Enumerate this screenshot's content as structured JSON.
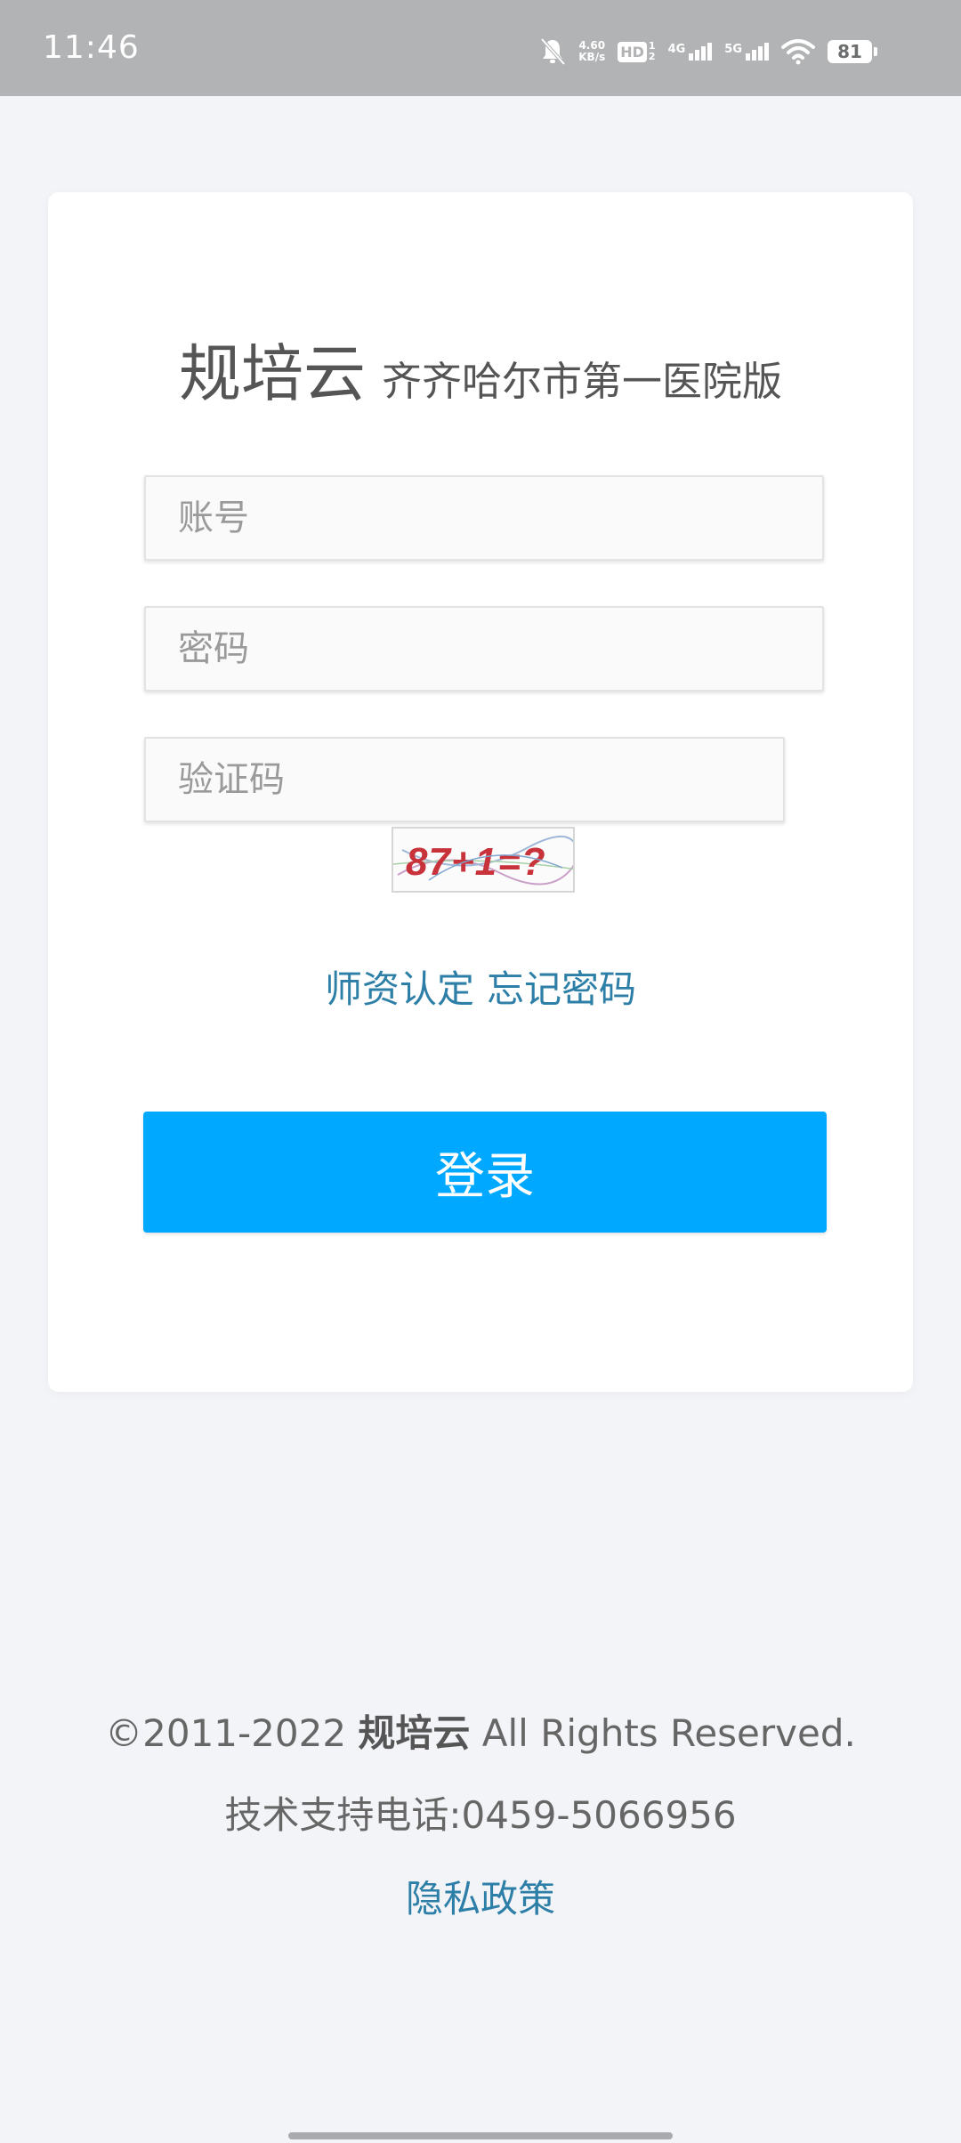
{
  "status_bar": {
    "time": "11:46",
    "net_speed_value": "4.60",
    "net_speed_unit": "KB/s",
    "hd_label": "HD",
    "hd_sub_top": "1",
    "hd_sub_bottom": "2",
    "sim1_label": "4G",
    "sim2_label": "5G",
    "battery": "81"
  },
  "brand": {
    "name": "规培云",
    "subtitle": "齐齐哈尔市第一医院版"
  },
  "form": {
    "account_placeholder": "账号",
    "password_placeholder": "密码",
    "captcha_placeholder": "验证码",
    "captcha_text": "87+1=?"
  },
  "links": {
    "teacher_cert": "师资认定",
    "forgot_password": "忘记密码"
  },
  "login_button": "登录",
  "footer": {
    "copyright_prefix": "©2011-2022 ",
    "copyright_brand": "规培云",
    "copyright_suffix": " All Rights Reserved.",
    "support_phone": "技术支持电话:0459-5066956",
    "privacy_policy": "隐私政策"
  },
  "colors": {
    "accent": "#00a9ff",
    "link": "#2e7fa7",
    "background": "#f3f4f8"
  }
}
